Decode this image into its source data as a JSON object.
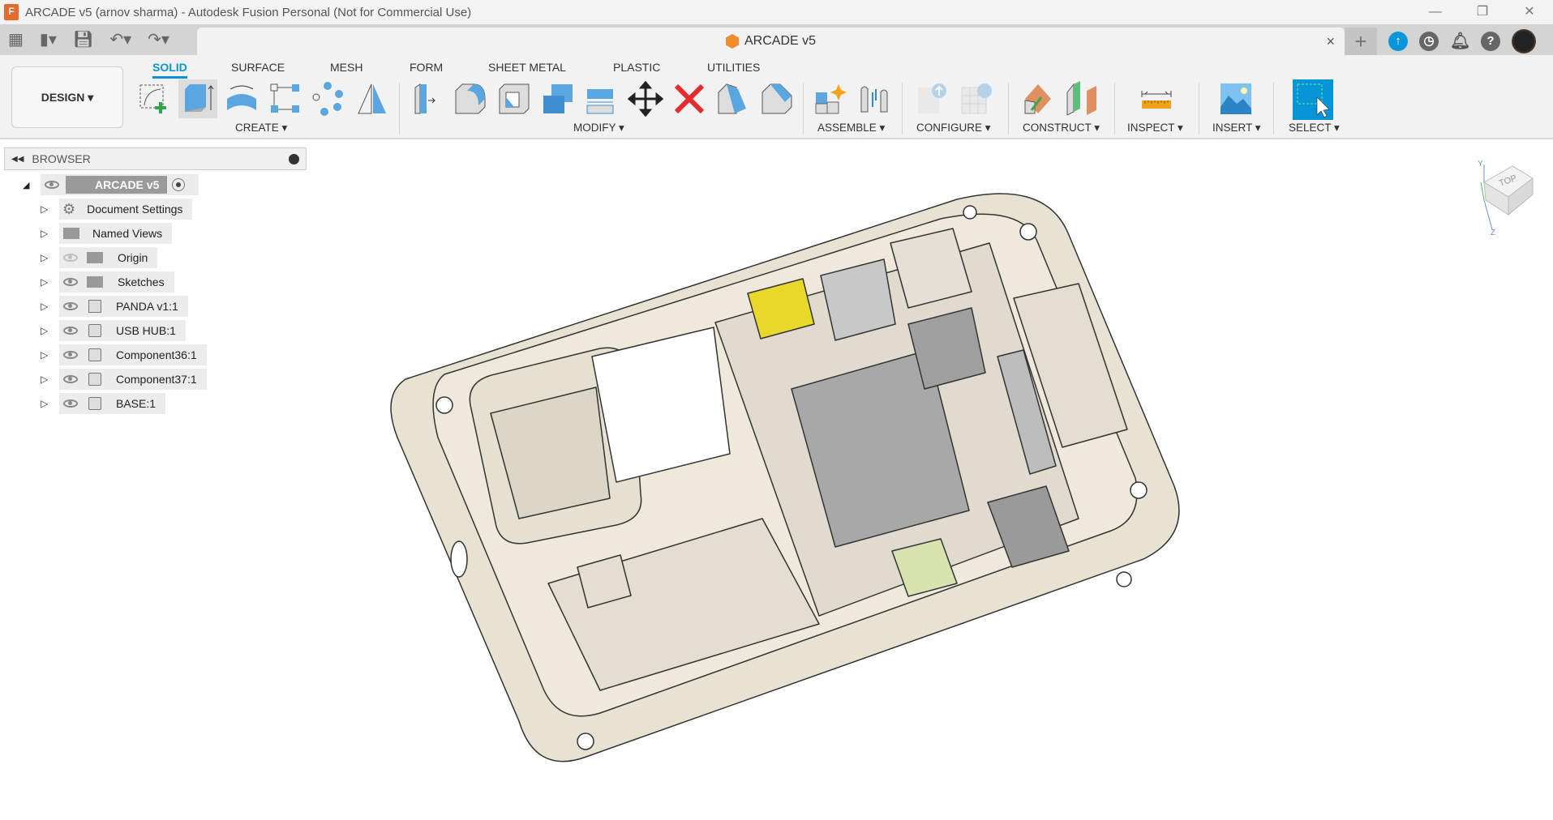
{
  "window": {
    "title": "ARCADE v5 (arnov sharma) - Autodesk Fusion Personal (Not for Commercial Use)",
    "app_icon": "F",
    "controls": [
      "minimize",
      "restore",
      "close"
    ]
  },
  "document_tab": {
    "title": "ARCADE v5",
    "close": "×"
  },
  "quick_access": [
    "apps-grid-icon",
    "file-icon",
    "save-icon",
    "undo-icon",
    "redo-icon"
  ],
  "right_icons": [
    "new-tab-plus-icon",
    "extensions-icon",
    "job-status-clock-icon",
    "notifications-bell-icon",
    "help-icon",
    "user-avatar"
  ],
  "workspace": {
    "label": "DESIGN ▾"
  },
  "tabs": [
    {
      "label": "SOLID",
      "active": true
    },
    {
      "label": "SURFACE"
    },
    {
      "label": "MESH"
    },
    {
      "label": "FORM"
    },
    {
      "label": "SHEET METAL"
    },
    {
      "label": "PLASTIC"
    },
    {
      "label": "UTILITIES"
    }
  ],
  "groups": [
    {
      "label": "CREATE ▾",
      "tools": [
        "create-sketch",
        "extrude",
        "revolve",
        "rectangular-pattern",
        "circular-pattern",
        "mirror-plane"
      ]
    },
    {
      "label": "MODIFY ▾",
      "tools": [
        "press-pull",
        "fillet",
        "shell",
        "combine",
        "offset-face",
        "move",
        "delete",
        "draft",
        "chamfer"
      ]
    },
    {
      "label": "ASSEMBLE ▾",
      "tools": [
        "new-component",
        "joint"
      ]
    },
    {
      "label": "CONFIGURE ▾",
      "tools": [
        "configure-design",
        "configure-table"
      ]
    },
    {
      "label": "CONSTRUCT ▾",
      "tools": [
        "plane-at-angle",
        "offset-plane"
      ]
    },
    {
      "label": "INSPECT ▾",
      "tools": [
        "measure"
      ]
    },
    {
      "label": "INSERT ▾",
      "tools": [
        "insert-image"
      ]
    },
    {
      "label": "SELECT ▾",
      "tools": [
        "window-select"
      ]
    }
  ],
  "browser": {
    "title": "BROWSER",
    "root": "ARCADE v5",
    "items": [
      {
        "label": "Document Settings",
        "icon": "gear"
      },
      {
        "label": "Named Views",
        "icon": "folder"
      },
      {
        "label": "Origin",
        "icon": "folder",
        "visible": false
      },
      {
        "label": "Sketches",
        "icon": "folder",
        "visible": true
      },
      {
        "label": "PANDA v1:1",
        "icon": "assembly",
        "visible": true
      },
      {
        "label": "USB HUB:1",
        "icon": "component",
        "visible": true
      },
      {
        "label": "Component36:1",
        "icon": "component",
        "visible": true
      },
      {
        "label": "Component37:1",
        "icon": "component",
        "visible": true
      },
      {
        "label": "BASE:1",
        "icon": "component",
        "visible": true
      }
    ]
  },
  "viewcube": {
    "face": "TOP",
    "axes": [
      "Y",
      "Z"
    ]
  },
  "colors": {
    "accent": "#0696d7",
    "model": "#e8e2d3",
    "hdmi": "#e8d82a",
    "sdcard": "#d8e4b0",
    "chip": "#a8a8a8"
  }
}
